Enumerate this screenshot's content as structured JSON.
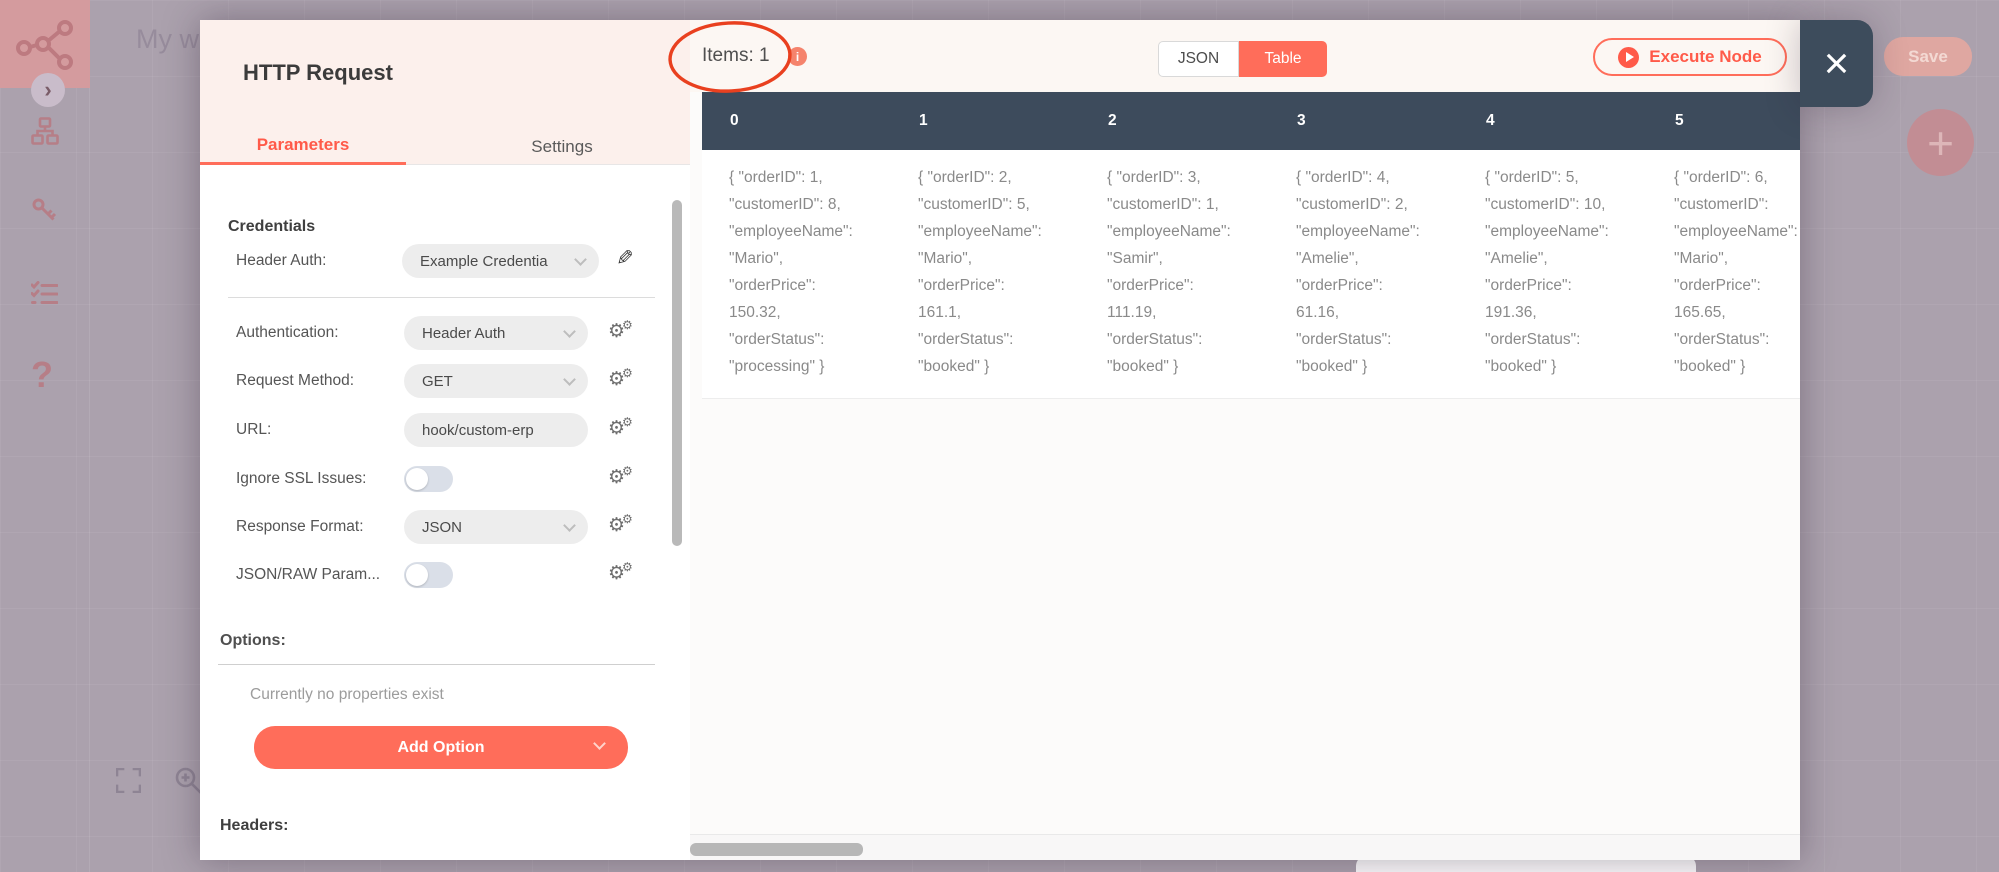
{
  "icons": {
    "gear": "⚙",
    "pencil": "✎",
    "close": "×",
    "chevron_right": "›",
    "help": "?",
    "info": "i",
    "plus": "+"
  },
  "colors": {
    "accent": "#ff6d5a",
    "table_header": "#3d4b5c",
    "annotation_red": "#e9401f",
    "modal_header_bg": "#fcf0ec",
    "overlay_canvas": "#aba1ad"
  },
  "canvas": {
    "workflow_title": "My wo",
    "save_label": "Save"
  },
  "modal": {
    "title": "HTTP Request",
    "tabs": {
      "parameters": "Parameters",
      "settings": "Settings"
    },
    "params": {
      "credentials_heading": "Credentials",
      "rows": [
        {
          "label": "Header Auth:",
          "control": "select",
          "value": "Example Credentia"
        },
        {
          "label": "Authentication:",
          "control": "select",
          "value": "Header Auth"
        },
        {
          "label": "Request Method:",
          "control": "select",
          "value": "GET"
        },
        {
          "label": "URL:",
          "control": "input",
          "value": "hook/custom-erp"
        },
        {
          "label": "Ignore SSL Issues:",
          "control": "toggle",
          "value": "off"
        },
        {
          "label": "Response Format:",
          "control": "select",
          "value": "JSON"
        },
        {
          "label": "JSON/RAW Param...",
          "control": "toggle",
          "value": "off"
        }
      ],
      "options_heading": "Options:",
      "options_empty_text": "Currently no properties exist",
      "add_option_label": "Add Option",
      "headers_heading": "Headers:"
    },
    "output": {
      "items_label": "Items: 1",
      "view_json_label": "JSON",
      "view_table_label": "Table",
      "active_view": "Table",
      "execute_label": "Execute Node",
      "table": {
        "columns": [
          "0",
          "1",
          "2",
          "3",
          "4",
          "5"
        ],
        "cells": [
          "{ \"orderID\": 1,\n\"customerID\": 8,\n\"employeeName\":\n\"Mario\",\n\"orderPrice\":\n150.32,\n\"orderStatus\":\n\"processing\" }",
          "{ \"orderID\": 2,\n\"customerID\": 5,\n\"employeeName\":\n\"Mario\",\n\"orderPrice\":\n161.1,\n\"orderStatus\":\n\"booked\" }",
          "{ \"orderID\": 3,\n\"customerID\": 1,\n\"employeeName\":\n\"Samir\",\n\"orderPrice\":\n111.19,\n\"orderStatus\":\n\"booked\" }",
          "{ \"orderID\": 4,\n\"customerID\": 2,\n\"employeeName\":\n\"Amelie\",\n\"orderPrice\":\n61.16,\n\"orderStatus\":\n\"booked\" }",
          "{ \"orderID\": 5,\n\"customerID\": 10,\n\"employeeName\":\n\"Amelie\",\n\"orderPrice\":\n191.36,\n\"orderStatus\":\n\"booked\" }",
          "{ \"orderID\": 6,\n\"customerID\":\n\"employeeName\":\n\"Mario\",\n\"orderPrice\":\n165.65,\n\"orderStatus\":\n\"booked\" }"
        ]
      }
    }
  }
}
